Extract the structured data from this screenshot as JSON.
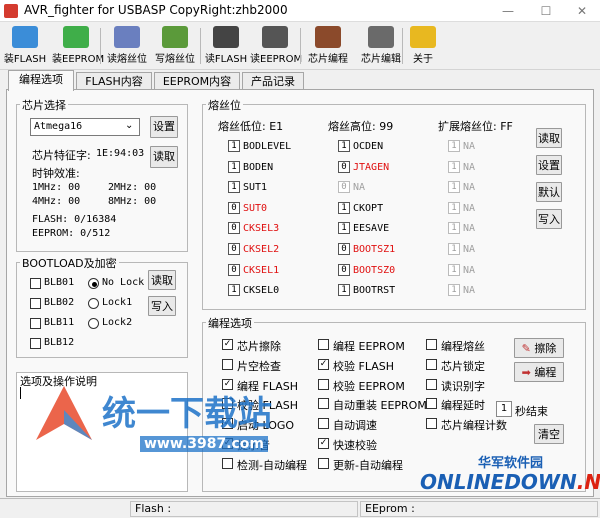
{
  "window": {
    "title": "AVR_fighter for USBASP CopyRight:zhb2000",
    "min": "—",
    "max": "☐",
    "close": "✕"
  },
  "toolbar": {
    "buttons": [
      {
        "label": "装FLASH",
        "icon": "flash-load-icon",
        "color": "#3b8dd8"
      },
      {
        "label": "装EEPROM",
        "icon": "eeprom-load-icon",
        "color": "#3fae49"
      },
      {
        "label": "读熔丝位",
        "icon": "fuse-read-icon",
        "color": "#6a7fbf"
      },
      {
        "label": "写熔丝位",
        "icon": "fuse-write-icon",
        "color": "#5b9a3a"
      },
      {
        "label": "读FLASH",
        "icon": "chip-read-flash-icon",
        "color": "#444444"
      },
      {
        "label": "读EEPROM",
        "icon": "chip-read-eeprom-icon",
        "color": "#555555"
      },
      {
        "label": "芯片编程",
        "icon": "chip-program-icon",
        "color": "#8b4a2b"
      },
      {
        "label": "芯片编辑",
        "icon": "chip-edit-icon",
        "color": "#6a6a6a"
      },
      {
        "label": "关于",
        "icon": "about-icon",
        "color": "#e8b820"
      }
    ]
  },
  "tabs": [
    "编程选项",
    "FLASH内容",
    "EEPROM内容",
    "产品记录"
  ],
  "chip": {
    "group_title": "芯片选择",
    "selected": "Atmega16",
    "settings_btn": "设置",
    "read_btn": "读取",
    "signature_label": "芯片特征字:",
    "signature_value": "1E:94:03",
    "clock_label": "时钟效准:",
    "clock_rows": [
      {
        "a": "1MHz: 00",
        "b": "2MHz: 00"
      },
      {
        "a": "4MHz: 00",
        "b": "8MHz: 00"
      }
    ],
    "flash": "FLASH: 0/16384",
    "eeprom": "EEPROM: 0/512"
  },
  "bootload": {
    "group_title": "BOOTLOAD及加密",
    "checks": [
      "BLB01",
      "BLB02",
      "BLB11",
      "BLB12"
    ],
    "radios": [
      {
        "label": "No Lock",
        "on": true
      },
      {
        "label": "Lock1",
        "on": false
      },
      {
        "label": "Lock2",
        "on": false
      }
    ],
    "read_btn": "读取",
    "write_btn": "写入"
  },
  "oplog": {
    "group_title": "选项及操作说明"
  },
  "fuse": {
    "group_title": "熔丝位",
    "low_label": "熔丝低位: E1",
    "high_label": "熔丝高位: 99",
    "ext_label": "扩展熔丝位: FF",
    "low": [
      {
        "v": "1",
        "name": "BODLEVEL",
        "red": false
      },
      {
        "v": "1",
        "name": "BODEN",
        "red": false
      },
      {
        "v": "1",
        "name": "SUT1",
        "red": false
      },
      {
        "v": "0",
        "name": "SUT0",
        "red": true
      },
      {
        "v": "0",
        "name": "CKSEL3",
        "red": true
      },
      {
        "v": "0",
        "name": "CKSEL2",
        "red": true
      },
      {
        "v": "0",
        "name": "CKSEL1",
        "red": true
      },
      {
        "v": "1",
        "name": "CKSEL0",
        "red": false
      }
    ],
    "high": [
      {
        "v": "1",
        "name": "OCDEN",
        "red": false,
        "gray": false
      },
      {
        "v": "0",
        "name": "JTAGEN",
        "red": true,
        "gray": false
      },
      {
        "v": "0",
        "name": "NA",
        "red": false,
        "gray": true
      },
      {
        "v": "1",
        "name": "CKOPT",
        "red": false,
        "gray": false
      },
      {
        "v": "1",
        "name": "EESAVE",
        "red": false,
        "gray": false
      },
      {
        "v": "0",
        "name": "BOOTSZ1",
        "red": true,
        "gray": false
      },
      {
        "v": "0",
        "name": "BOOTSZ0",
        "red": true,
        "gray": false
      },
      {
        "v": "1",
        "name": "BOOTRST",
        "red": false,
        "gray": false
      }
    ],
    "ext": [
      {
        "v": "1",
        "name": "NA"
      },
      {
        "v": "1",
        "name": "NA"
      },
      {
        "v": "1",
        "name": "NA"
      },
      {
        "v": "1",
        "name": "NA"
      },
      {
        "v": "1",
        "name": "NA"
      },
      {
        "v": "1",
        "name": "NA"
      },
      {
        "v": "1",
        "name": "NA"
      },
      {
        "v": "1",
        "name": "NA"
      }
    ],
    "buttons": [
      "读取",
      "设置",
      "默认",
      "写入"
    ]
  },
  "progopt": {
    "group_title": "编程选项",
    "col1": [
      {
        "label": "芯片擦除",
        "checked": true
      },
      {
        "label": "片空检查",
        "checked": false
      },
      {
        "label": "编程 FLASH",
        "checked": true
      },
      {
        "label": "校验 FLASH",
        "checked": false
      },
      {
        "label": "启动 LOGO",
        "checked": true
      },
      {
        "label": "提示音",
        "checked": true
      },
      {
        "label": "检测-自动编程",
        "checked": false
      }
    ],
    "col2": [
      {
        "label": "编程 EEPROM",
        "checked": false
      },
      {
        "label": "校验 FLASH",
        "checked": true
      },
      {
        "label": "校验 EEPROM",
        "checked": false
      },
      {
        "label": "自动重装 EEPROM",
        "checked": false
      },
      {
        "label": "自动调速",
        "checked": false
      },
      {
        "label": "快速校验",
        "checked": true
      },
      {
        "label": "更新-自动编程",
        "checked": false
      }
    ],
    "col3": [
      {
        "label": "编程熔丝",
        "checked": false
      },
      {
        "label": "芯片锁定",
        "checked": false
      },
      {
        "label": "读识别字",
        "checked": false
      },
      {
        "label": "编程延时",
        "checked": false
      },
      {
        "label": "芯片编程计数",
        "checked": false
      }
    ],
    "delay_value": "1",
    "delay_unit": "秒结束",
    "erase_btn": "擦除",
    "program_btn": "编程",
    "clear_btn": "清空"
  },
  "status": {
    "flash": "Flash :",
    "eeprom": "EEprom :"
  },
  "watermark": {
    "cn_text": "统一下载站",
    "site": "www.3987.com",
    "brand_cn": "华军软件园",
    "brand_en": "ONLINEDOWN",
    "brand_dot": ".NET"
  }
}
